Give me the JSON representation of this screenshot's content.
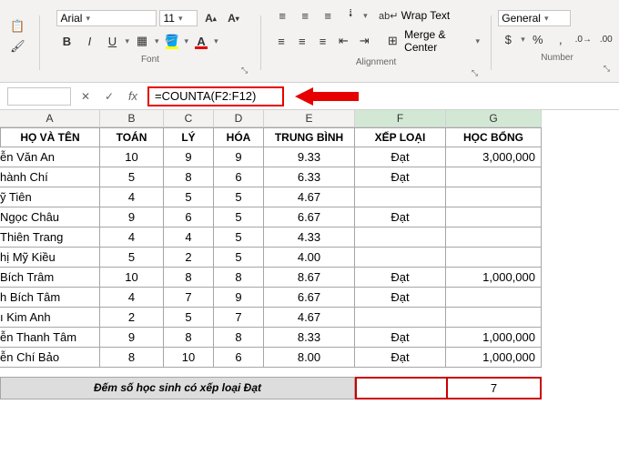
{
  "ribbon": {
    "font_name": "Arial",
    "font_size": "11",
    "wrap_text": "Wrap Text",
    "merge_center": "Merge & Center",
    "number_format": "General",
    "group_font": "Font",
    "group_align": "Alignment",
    "group_number": "Number"
  },
  "formula_bar": {
    "formula": "=COUNTA(F2:F12)"
  },
  "columns": [
    "A",
    "B",
    "C",
    "D",
    "E",
    "F",
    "G"
  ],
  "headers": [
    "HỌ VÀ TÊN",
    "TOÁN",
    "LÝ",
    "HÓA",
    "TRUNG BÌNH",
    "XẾP LOẠI",
    "HỌC BỔNG"
  ],
  "rows": [
    {
      "name": "ễn Văn An",
      "toan": "10",
      "ly": "9",
      "hoa": "9",
      "tb": "9.33",
      "xl": "Đạt",
      "hb": "3,000,000"
    },
    {
      "name": "hành Chí",
      "toan": "5",
      "ly": "8",
      "hoa": "6",
      "tb": "6.33",
      "xl": "Đạt",
      "hb": ""
    },
    {
      "name": "ỹ Tiên",
      "toan": "4",
      "ly": "5",
      "hoa": "5",
      "tb": "4.67",
      "xl": "",
      "hb": ""
    },
    {
      "name": "Ngọc Châu",
      "toan": "9",
      "ly": "6",
      "hoa": "5",
      "tb": "6.67",
      "xl": "Đạt",
      "hb": ""
    },
    {
      "name": "Thiên Trang",
      "toan": "4",
      "ly": "4",
      "hoa": "5",
      "tb": "4.33",
      "xl": "",
      "hb": ""
    },
    {
      "name": "hị Mỹ Kiều",
      "toan": "5",
      "ly": "2",
      "hoa": "5",
      "tb": "4.00",
      "xl": "",
      "hb": ""
    },
    {
      "name": "Bích Trâm",
      "toan": "10",
      "ly": "8",
      "hoa": "8",
      "tb": "8.67",
      "xl": "Đạt",
      "hb": "1,000,000"
    },
    {
      "name": "h Bích Tâm",
      "toan": "4",
      "ly": "7",
      "hoa": "9",
      "tb": "6.67",
      "xl": "Đạt",
      "hb": ""
    },
    {
      "name": "ı Kim Anh",
      "toan": "2",
      "ly": "5",
      "hoa": "7",
      "tb": "4.67",
      "xl": "",
      "hb": ""
    },
    {
      "name": "ễn Thanh Tâm",
      "toan": "9",
      "ly": "8",
      "hoa": "8",
      "tb": "8.33",
      "xl": "Đạt",
      "hb": "1,000,000"
    },
    {
      "name": "ễn Chí Bảo",
      "toan": "8",
      "ly": "10",
      "hoa": "6",
      "tb": "8.00",
      "xl": "Đạt",
      "hb": "1,000,000"
    }
  ],
  "summary": {
    "label": "Đếm số học sinh có xếp loại Đạt",
    "value": "7"
  },
  "chart_data": {
    "type": "table",
    "title": "Student scores and classification",
    "columns": [
      "HỌ VÀ TÊN",
      "TOÁN",
      "LÝ",
      "HÓA",
      "TRUNG BÌNH",
      "XẾP LOẠI",
      "HỌC BỔNG"
    ],
    "rows": [
      [
        "ễn Văn An",
        10,
        9,
        9,
        9.33,
        "Đạt",
        3000000
      ],
      [
        "hành Chí",
        5,
        8,
        6,
        6.33,
        "Đạt",
        null
      ],
      [
        "ỹ Tiên",
        4,
        5,
        5,
        4.67,
        "",
        null
      ],
      [
        "Ngọc Châu",
        9,
        6,
        5,
        6.67,
        "Đạt",
        null
      ],
      [
        "Thiên Trang",
        4,
        4,
        5,
        4.33,
        "",
        null
      ],
      [
        "hị Mỹ Kiều",
        5,
        2,
        5,
        4.0,
        "",
        null
      ],
      [
        "Bích Trâm",
        10,
        8,
        8,
        8.67,
        "Đạt",
        1000000
      ],
      [
        "h Bích Tâm",
        4,
        7,
        9,
        6.67,
        "Đạt",
        null
      ],
      [
        "ı Kim Anh",
        2,
        5,
        7,
        4.67,
        "",
        null
      ],
      [
        "ễn Thanh Tâm",
        9,
        8,
        8,
        8.33,
        "Đạt",
        1000000
      ],
      [
        "ễn Chí Bảo",
        8,
        10,
        6,
        8.0,
        "Đạt",
        1000000
      ]
    ],
    "summary": {
      "formula": "=COUNTA(F2:F12)",
      "label": "Đếm số học sinh có xếp loại Đạt",
      "result": 7
    }
  }
}
